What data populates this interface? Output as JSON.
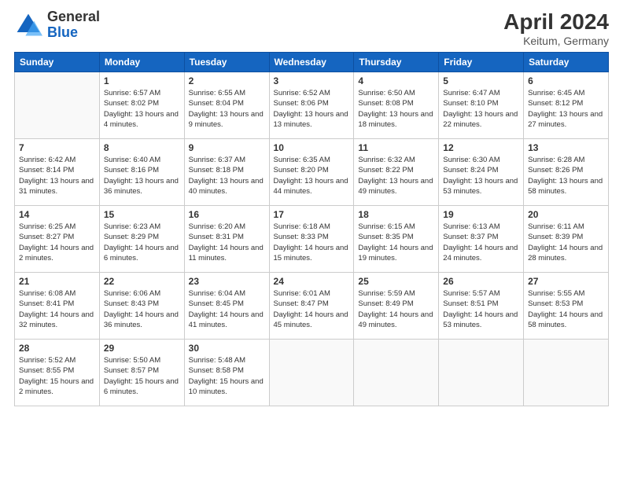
{
  "header": {
    "logo_general": "General",
    "logo_blue": "Blue",
    "month": "April 2024",
    "location": "Keitum, Germany"
  },
  "days_of_week": [
    "Sunday",
    "Monday",
    "Tuesday",
    "Wednesday",
    "Thursday",
    "Friday",
    "Saturday"
  ],
  "weeks": [
    [
      {
        "day": "",
        "sunrise": "",
        "sunset": "",
        "daylight": ""
      },
      {
        "day": "1",
        "sunrise": "Sunrise: 6:57 AM",
        "sunset": "Sunset: 8:02 PM",
        "daylight": "Daylight: 13 hours and 4 minutes."
      },
      {
        "day": "2",
        "sunrise": "Sunrise: 6:55 AM",
        "sunset": "Sunset: 8:04 PM",
        "daylight": "Daylight: 13 hours and 9 minutes."
      },
      {
        "day": "3",
        "sunrise": "Sunrise: 6:52 AM",
        "sunset": "Sunset: 8:06 PM",
        "daylight": "Daylight: 13 hours and 13 minutes."
      },
      {
        "day": "4",
        "sunrise": "Sunrise: 6:50 AM",
        "sunset": "Sunset: 8:08 PM",
        "daylight": "Daylight: 13 hours and 18 minutes."
      },
      {
        "day": "5",
        "sunrise": "Sunrise: 6:47 AM",
        "sunset": "Sunset: 8:10 PM",
        "daylight": "Daylight: 13 hours and 22 minutes."
      },
      {
        "day": "6",
        "sunrise": "Sunrise: 6:45 AM",
        "sunset": "Sunset: 8:12 PM",
        "daylight": "Daylight: 13 hours and 27 minutes."
      }
    ],
    [
      {
        "day": "7",
        "sunrise": "Sunrise: 6:42 AM",
        "sunset": "Sunset: 8:14 PM",
        "daylight": "Daylight: 13 hours and 31 minutes."
      },
      {
        "day": "8",
        "sunrise": "Sunrise: 6:40 AM",
        "sunset": "Sunset: 8:16 PM",
        "daylight": "Daylight: 13 hours and 36 minutes."
      },
      {
        "day": "9",
        "sunrise": "Sunrise: 6:37 AM",
        "sunset": "Sunset: 8:18 PM",
        "daylight": "Daylight: 13 hours and 40 minutes."
      },
      {
        "day": "10",
        "sunrise": "Sunrise: 6:35 AM",
        "sunset": "Sunset: 8:20 PM",
        "daylight": "Daylight: 13 hours and 44 minutes."
      },
      {
        "day": "11",
        "sunrise": "Sunrise: 6:32 AM",
        "sunset": "Sunset: 8:22 PM",
        "daylight": "Daylight: 13 hours and 49 minutes."
      },
      {
        "day": "12",
        "sunrise": "Sunrise: 6:30 AM",
        "sunset": "Sunset: 8:24 PM",
        "daylight": "Daylight: 13 hours and 53 minutes."
      },
      {
        "day": "13",
        "sunrise": "Sunrise: 6:28 AM",
        "sunset": "Sunset: 8:26 PM",
        "daylight": "Daylight: 13 hours and 58 minutes."
      }
    ],
    [
      {
        "day": "14",
        "sunrise": "Sunrise: 6:25 AM",
        "sunset": "Sunset: 8:27 PM",
        "daylight": "Daylight: 14 hours and 2 minutes."
      },
      {
        "day": "15",
        "sunrise": "Sunrise: 6:23 AM",
        "sunset": "Sunset: 8:29 PM",
        "daylight": "Daylight: 14 hours and 6 minutes."
      },
      {
        "day": "16",
        "sunrise": "Sunrise: 6:20 AM",
        "sunset": "Sunset: 8:31 PM",
        "daylight": "Daylight: 14 hours and 11 minutes."
      },
      {
        "day": "17",
        "sunrise": "Sunrise: 6:18 AM",
        "sunset": "Sunset: 8:33 PM",
        "daylight": "Daylight: 14 hours and 15 minutes."
      },
      {
        "day": "18",
        "sunrise": "Sunrise: 6:15 AM",
        "sunset": "Sunset: 8:35 PM",
        "daylight": "Daylight: 14 hours and 19 minutes."
      },
      {
        "day": "19",
        "sunrise": "Sunrise: 6:13 AM",
        "sunset": "Sunset: 8:37 PM",
        "daylight": "Daylight: 14 hours and 24 minutes."
      },
      {
        "day": "20",
        "sunrise": "Sunrise: 6:11 AM",
        "sunset": "Sunset: 8:39 PM",
        "daylight": "Daylight: 14 hours and 28 minutes."
      }
    ],
    [
      {
        "day": "21",
        "sunrise": "Sunrise: 6:08 AM",
        "sunset": "Sunset: 8:41 PM",
        "daylight": "Daylight: 14 hours and 32 minutes."
      },
      {
        "day": "22",
        "sunrise": "Sunrise: 6:06 AM",
        "sunset": "Sunset: 8:43 PM",
        "daylight": "Daylight: 14 hours and 36 minutes."
      },
      {
        "day": "23",
        "sunrise": "Sunrise: 6:04 AM",
        "sunset": "Sunset: 8:45 PM",
        "daylight": "Daylight: 14 hours and 41 minutes."
      },
      {
        "day": "24",
        "sunrise": "Sunrise: 6:01 AM",
        "sunset": "Sunset: 8:47 PM",
        "daylight": "Daylight: 14 hours and 45 minutes."
      },
      {
        "day": "25",
        "sunrise": "Sunrise: 5:59 AM",
        "sunset": "Sunset: 8:49 PM",
        "daylight": "Daylight: 14 hours and 49 minutes."
      },
      {
        "day": "26",
        "sunrise": "Sunrise: 5:57 AM",
        "sunset": "Sunset: 8:51 PM",
        "daylight": "Daylight: 14 hours and 53 minutes."
      },
      {
        "day": "27",
        "sunrise": "Sunrise: 5:55 AM",
        "sunset": "Sunset: 8:53 PM",
        "daylight": "Daylight: 14 hours and 58 minutes."
      }
    ],
    [
      {
        "day": "28",
        "sunrise": "Sunrise: 5:52 AM",
        "sunset": "Sunset: 8:55 PM",
        "daylight": "Daylight: 15 hours and 2 minutes."
      },
      {
        "day": "29",
        "sunrise": "Sunrise: 5:50 AM",
        "sunset": "Sunset: 8:57 PM",
        "daylight": "Daylight: 15 hours and 6 minutes."
      },
      {
        "day": "30",
        "sunrise": "Sunrise: 5:48 AM",
        "sunset": "Sunset: 8:58 PM",
        "daylight": "Daylight: 15 hours and 10 minutes."
      },
      {
        "day": "",
        "sunrise": "",
        "sunset": "",
        "daylight": ""
      },
      {
        "day": "",
        "sunrise": "",
        "sunset": "",
        "daylight": ""
      },
      {
        "day": "",
        "sunrise": "",
        "sunset": "",
        "daylight": ""
      },
      {
        "day": "",
        "sunrise": "",
        "sunset": "",
        "daylight": ""
      }
    ]
  ]
}
